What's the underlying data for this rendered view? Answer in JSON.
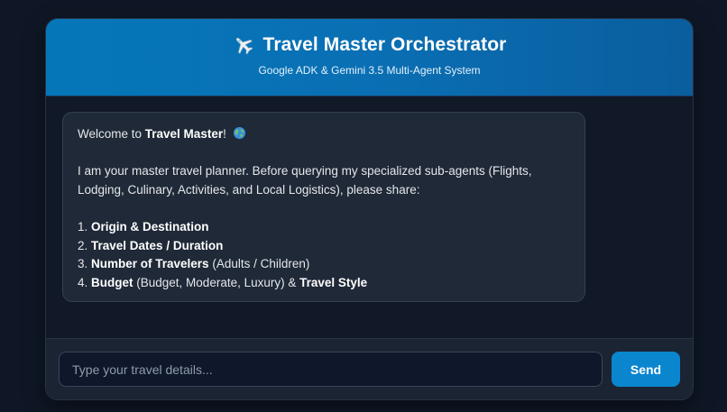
{
  "header": {
    "title": "Travel Master Orchestrator",
    "subtitle": "Google ADK & Gemini 3.5 Multi-Agent System",
    "icon": "airplane-icon"
  },
  "message": {
    "welcome_prefix": "Welcome to ",
    "welcome_name": "Travel Master",
    "welcome_suffix": "!",
    "welcome_icon": "globe-icon",
    "intro_line1": "I am your master travel planner. Before querying my specialized sub-agents (Flights,",
    "intro_line2": "Lodging, Culinary, Activities, and Local Logistics), please share:",
    "items": [
      {
        "num": "1. ",
        "bold": "Origin & Destination",
        "rest": ""
      },
      {
        "num": "2. ",
        "bold": "Travel Dates / Duration",
        "rest": ""
      },
      {
        "num": "3. ",
        "bold": "Number of Travelers",
        "rest": " (Adults / Children)"
      },
      {
        "num": "4. ",
        "bold": "Budget",
        "rest": " (Budget, Moderate, Luxury) & ",
        "bold2": "Travel Style"
      }
    ]
  },
  "composer": {
    "placeholder": "Type your travel details...",
    "value": "",
    "send_label": "Send"
  },
  "colors": {
    "header_start": "#0577b9",
    "header_end": "#0a5e9e",
    "send_button": "#0a86cf",
    "background": "#0f1726"
  }
}
